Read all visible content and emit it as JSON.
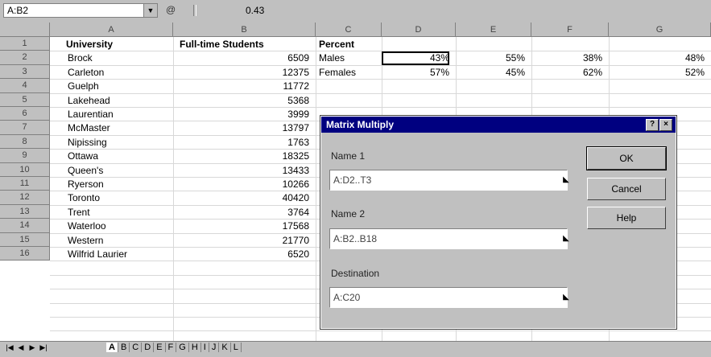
{
  "formula_bar": {
    "name_box": "A:B2",
    "fx_icon": "@",
    "content": "0.43"
  },
  "columns": [
    {
      "letter": "A"
    },
    {
      "letter": "B"
    },
    {
      "letter": "C"
    },
    {
      "letter": "D"
    },
    {
      "letter": "E"
    },
    {
      "letter": "F"
    },
    {
      "letter": "G"
    }
  ],
  "headers": {
    "university": "University",
    "students": "Full-time Students",
    "percent": "Percent"
  },
  "rows": [
    {
      "num": "1",
      "name": "Brock",
      "value": "6509"
    },
    {
      "num": "2",
      "name": "Carleton",
      "value": "12375"
    },
    {
      "num": "3",
      "name": "Guelph",
      "value": "11772"
    },
    {
      "num": "4",
      "name": "Lakehead",
      "value": "5368"
    },
    {
      "num": "5",
      "name": "Laurentian",
      "value": "3999"
    },
    {
      "num": "6",
      "name": "McMaster",
      "value": "13797"
    },
    {
      "num": "7",
      "name": "Nipissing",
      "value": "1763"
    },
    {
      "num": "8",
      "name": "Ottawa",
      "value": "18325"
    },
    {
      "num": "9",
      "name": "Queen's",
      "value": "13433"
    },
    {
      "num": "10",
      "name": "Ryerson",
      "value": "10266"
    },
    {
      "num": "11",
      "name": "Toronto",
      "value": "40420"
    },
    {
      "num": "12",
      "name": "Trent",
      "value": "3764"
    },
    {
      "num": "13",
      "name": "Waterloo",
      "value": "17568"
    },
    {
      "num": "14",
      "name": "Western",
      "value": "21770"
    },
    {
      "num": "15",
      "name": "Wilfrid Laurier",
      "value": "6520"
    }
  ],
  "percent_rows": [
    {
      "label": "Males",
      "values": [
        "43%",
        "55%",
        "38%",
        "48%"
      ]
    },
    {
      "label": "Females",
      "values": [
        "57%",
        "45%",
        "62%",
        "52%"
      ]
    }
  ],
  "dialog": {
    "title": "Matrix Multiply",
    "name1_label": "Name 1",
    "name1_value": "A:D2..T3",
    "name2_label": "Name 2",
    "name2_value": "A:B2..B18",
    "dest_label": "Destination",
    "dest_value": "A:C20",
    "ok": "OK",
    "cancel": "Cancel",
    "help": "Help",
    "help_btn": "?",
    "close_btn": "×"
  },
  "sheet_tabs": {
    "nav": [
      "|◀",
      "◀",
      "▶",
      "▶|"
    ],
    "tabs": [
      "A",
      "B",
      "C",
      "D",
      "E",
      "F",
      "G",
      "H",
      "I",
      "J",
      "K",
      "L"
    ],
    "active_index": 0
  }
}
